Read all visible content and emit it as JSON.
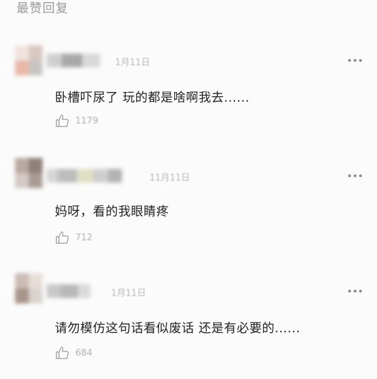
{
  "header": {
    "title": "最赞回复"
  },
  "comments": [
    {
      "date": "1月11日",
      "text": "卧槽吓尿了 玩的都是啥啊我去......",
      "likes": "1179"
    },
    {
      "date": "11月11日",
      "text": "妈呀，看的我眼睛疼",
      "likes": "712"
    },
    {
      "date": "1月11日",
      "text": "请勿模仿这句话看似废话  还是有必要的......",
      "likes": "684"
    }
  ],
  "icons": {
    "more": "more-dots-icon",
    "like": "thumbs-up-icon"
  }
}
